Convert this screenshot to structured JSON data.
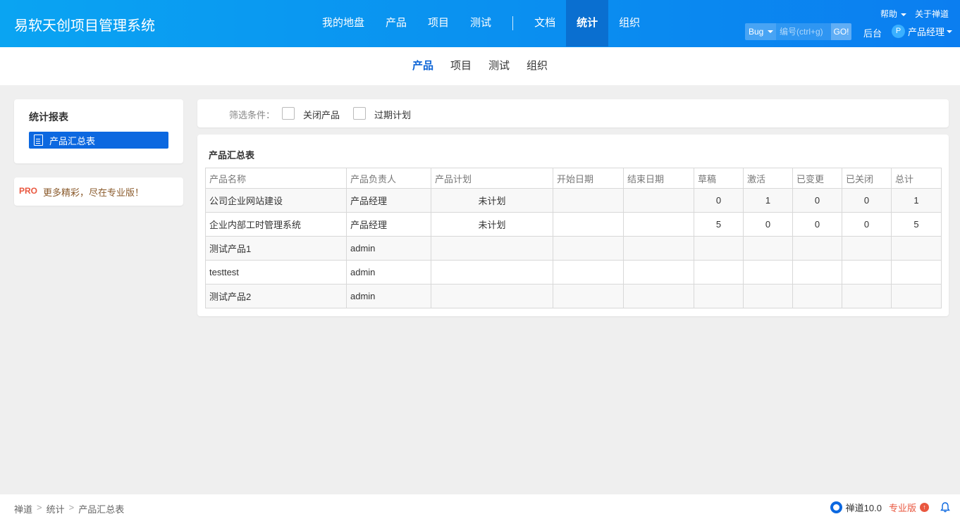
{
  "app": {
    "brand": "易软天创项目管理系统"
  },
  "mainnav": [
    {
      "label": "我的地盘"
    },
    {
      "label": "产品"
    },
    {
      "label": "项目"
    },
    {
      "label": "测试"
    },
    {
      "label": "文档"
    },
    {
      "label": "统计",
      "active": true
    },
    {
      "label": "组织"
    }
  ],
  "topright": {
    "help": "帮助",
    "about": "关于禅道"
  },
  "search": {
    "type": "Bug",
    "placeholder": "编号(ctrl+g)",
    "go": "GO!"
  },
  "admin": "后台",
  "user": {
    "avatar": "P",
    "name": "产品经理"
  },
  "subnav": [
    {
      "label": "产品",
      "active": true
    },
    {
      "label": "项目"
    },
    {
      "label": "测试"
    },
    {
      "label": "组织"
    }
  ],
  "sidebar": {
    "title": "统计报表",
    "item": "产品汇总表"
  },
  "pro": {
    "badge": "PRO",
    "text": "更多精彩，尽在专业版！"
  },
  "filter": {
    "label": "筛选条件：",
    "options": [
      "关闭产品",
      "过期计划"
    ]
  },
  "report": {
    "title": "产品汇总表",
    "columns": [
      "产品名称",
      "产品负责人",
      "产品计划",
      "开始日期",
      "结束日期",
      "草稿",
      "激活",
      "已变更",
      "已关闭",
      "总计"
    ],
    "rows": [
      [
        "公司企业网站建设",
        "产品经理",
        "未计划",
        "",
        "",
        "0",
        "1",
        "0",
        "0",
        "1"
      ],
      [
        "企业内部工时管理系统",
        "产品经理",
        "未计划",
        "",
        "",
        "5",
        "0",
        "0",
        "0",
        "5"
      ],
      [
        "测试产品1",
        "admin",
        "",
        "",
        "",
        "",
        "",
        "",
        "",
        ""
      ],
      [
        "testtest",
        "admin",
        "",
        "",
        "",
        "",
        "",
        "",
        "",
        ""
      ],
      [
        "测试产品2",
        "admin",
        "",
        "",
        "",
        "",
        "",
        "",
        "",
        ""
      ]
    ]
  },
  "breadcrumb": [
    "禅道",
    "统计",
    "产品汇总表"
  ],
  "footer": {
    "version": "禅道10.0",
    "pro": "专业版"
  },
  "colors": {
    "header": "#0a8ff0",
    "active_nav": "#0a6fd0",
    "accent": "#0c68e0",
    "pro": "#e9573f"
  },
  "icons": [
    "document-icon",
    "zentao-logo-icon",
    "upgrade-arrow-icon",
    "bell-icon",
    "caret-down-icon"
  ]
}
